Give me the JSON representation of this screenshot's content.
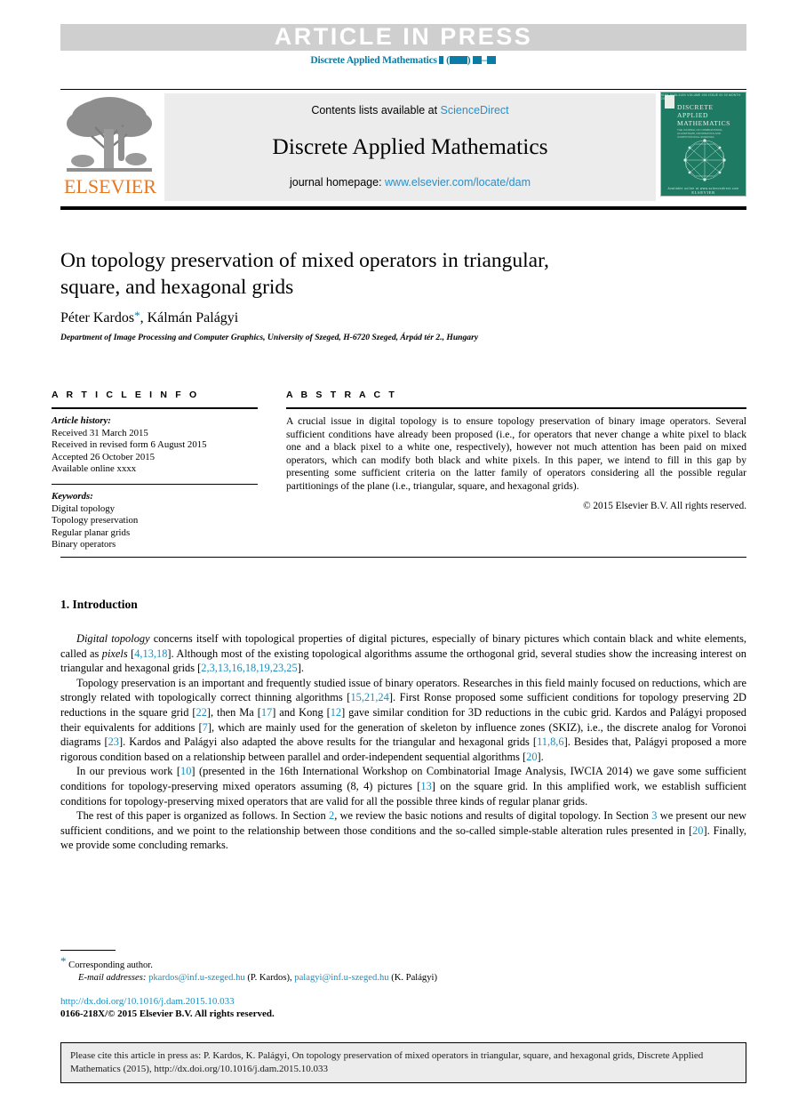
{
  "header": {
    "article_in_press": "ARTICLE IN PRESS",
    "citation_prefix": "Discrete Applied Mathematics",
    "accent_color": "#0a7ca5",
    "band_color": "#cfcfcf"
  },
  "masthead": {
    "publisher": "ELSEVIER",
    "contents_prefix": "Contents lists available at ",
    "sciencedirect": "ScienceDirect",
    "journal_name": "Discrete Applied Mathematics",
    "homepage_label": "journal homepage: ",
    "homepage_url": "www.elsevier.com/locate/dam",
    "cover": {
      "top_strip": "ISSN 0166-218X   VOLUME 000 ISSUE 00   00 MONTH 2015",
      "line1": "DISCRETE",
      "line2": "APPLIED",
      "line3": "MATHEMATICS",
      "subtitle": "THE JOURNAL OF COMBINATORIAL ALGORITHMS, INFORMATICS AND COMPUTATIONAL SCIENCES",
      "footer_small": "Available online at www.sciencedirect.com",
      "footer_brand": "ELSEVIER"
    },
    "link_color": "#2a8fc9",
    "cover_color": "#1f7a63",
    "elsevier_orange": "#e87722"
  },
  "article": {
    "title_line1": "On topology preservation of mixed operators in triangular,",
    "title_line2": "square, and hexagonal grids",
    "author1": "Péter Kardos",
    "author_sep": ", ",
    "author2": "Kálmán Palágyi",
    "corresponding_marker": "*",
    "affiliation": "Department of Image Processing and Computer Graphics, University of Szeged, H-6720 Szeged, Árpád tér 2., Hungary"
  },
  "article_info": {
    "heading": "A R T I C L E   I N F O",
    "history_label": "Article history:",
    "history": [
      "Received 31 March 2015",
      "Received in revised form 6 August 2015",
      "Accepted 26 October 2015",
      "Available online xxxx"
    ],
    "keywords_label": "Keywords:",
    "keywords": [
      "Digital topology",
      "Topology preservation",
      "Regular planar grids",
      "Binary operators"
    ]
  },
  "abstract": {
    "heading": "A B S T R A C T",
    "text": "A crucial issue in digital topology is to ensure topology preservation of binary image operators. Several sufficient conditions have already been proposed (i.e., for operators that never change a white pixel to black one and a black pixel to a white one, respectively), however not much attention has been paid on mixed operators, which can modify both black and white pixels. In this paper, we intend to fill in this gap by presenting some sufficient criteria on the latter family of operators considering all the possible regular partitionings of the plane (i.e., triangular, square, and hexagonal grids).",
    "copyright": "© 2015 Elsevier B.V. All rights reserved."
  },
  "section1": {
    "heading": "1. Introduction",
    "paragraphs": [
      {
        "parts": [
          {
            "t": "Digital topology",
            "s": "it"
          },
          {
            "t": " concerns itself with topological properties of digital pictures, especially of binary pictures which contain black and white elements, called as ",
            "s": ""
          },
          {
            "t": "pixels",
            "s": "it"
          },
          {
            "t": " [",
            "s": ""
          },
          {
            "t": "4,13,18",
            "s": "ref"
          },
          {
            "t": "]. Although most of the existing topological algorithms assume the orthogonal grid, several studies show the increasing interest on triangular and hexagonal grids [",
            "s": ""
          },
          {
            "t": "2,3,13,16,18,19,23,25",
            "s": "ref"
          },
          {
            "t": "].",
            "s": ""
          }
        ]
      },
      {
        "parts": [
          {
            "t": "Topology preservation is an important and frequently studied issue of binary operators. Researches in this field mainly focused on reductions, which are strongly related with topologically correct thinning algorithms [",
            "s": ""
          },
          {
            "t": "15,21,24",
            "s": "ref"
          },
          {
            "t": "]. First Ronse proposed some sufficient conditions for topology preserving 2D reductions in the square grid [",
            "s": ""
          },
          {
            "t": "22",
            "s": "ref"
          },
          {
            "t": "], then Ma [",
            "s": ""
          },
          {
            "t": "17",
            "s": "ref"
          },
          {
            "t": "] and Kong [",
            "s": ""
          },
          {
            "t": "12",
            "s": "ref"
          },
          {
            "t": "] gave similar condition for 3D reductions in the cubic grid. Kardos and Palágyi proposed their equivalents for additions [",
            "s": ""
          },
          {
            "t": "7",
            "s": "ref"
          },
          {
            "t": "], which are mainly used for the generation of skeleton by influence zones (SKIZ), i.e., the discrete analog for Voronoi diagrams [",
            "s": ""
          },
          {
            "t": "23",
            "s": "ref"
          },
          {
            "t": "]. Kardos and Palágyi also adapted the above results for the triangular and hexagonal grids [",
            "s": ""
          },
          {
            "t": "11,8,6",
            "s": "ref"
          },
          {
            "t": "]. Besides that, Palágyi proposed a more rigorous condition based on a relationship between parallel and order-independent sequential algorithms [",
            "s": ""
          },
          {
            "t": "20",
            "s": "ref"
          },
          {
            "t": "].",
            "s": ""
          }
        ]
      },
      {
        "parts": [
          {
            "t": "In our previous work [",
            "s": ""
          },
          {
            "t": "10",
            "s": "ref"
          },
          {
            "t": "] (presented in the 16th International Workshop on Combinatorial Image Analysis, IWCIA 2014) we gave some sufficient conditions for topology-preserving mixed operators assuming (8, 4) pictures [",
            "s": ""
          },
          {
            "t": "13",
            "s": "ref"
          },
          {
            "t": "] on the square grid. In this amplified work, we establish sufficient conditions for topology-preserving mixed operators that are valid for all the possible three kinds of regular planar grids.",
            "s": ""
          }
        ]
      },
      {
        "parts": [
          {
            "t": "The rest of this paper is organized as follows. In Section ",
            "s": ""
          },
          {
            "t": "2",
            "s": "ref"
          },
          {
            "t": ", we review the basic notions and results of digital topology. In Section ",
            "s": ""
          },
          {
            "t": "3",
            "s": "ref"
          },
          {
            "t": " we present our new sufficient conditions, and we point to the relationship between those conditions and the so-called simple-stable alteration rules presented in [",
            "s": ""
          },
          {
            "t": "20",
            "s": "ref"
          },
          {
            "t": "]. Finally, we provide some concluding remarks.",
            "s": ""
          }
        ]
      }
    ]
  },
  "footnotes": {
    "corresponding_marker": "*",
    "corresponding_text": "Corresponding author.",
    "emails_label": "E-mail addresses:",
    "email1": "pkardos@inf.u-szeged.hu",
    "email1_name": "(P. Kardos)",
    "email_sep": ", ",
    "email2": "palagyi@inf.u-szeged.hu",
    "email2_name": "(K. Palágyi)",
    "doi": "http://dx.doi.org/10.1016/j.dam.2015.10.033",
    "issn": "0166-218X/© 2015 Elsevier B.V. All rights reserved."
  },
  "cite_box": {
    "text": "Please cite this article in press as: P. Kardos, K. Palágyi, On topology preservation of mixed operators in triangular, square, and hexagonal grids, Discrete Applied Mathematics (2015), http://dx.doi.org/10.1016/j.dam.2015.10.033"
  }
}
